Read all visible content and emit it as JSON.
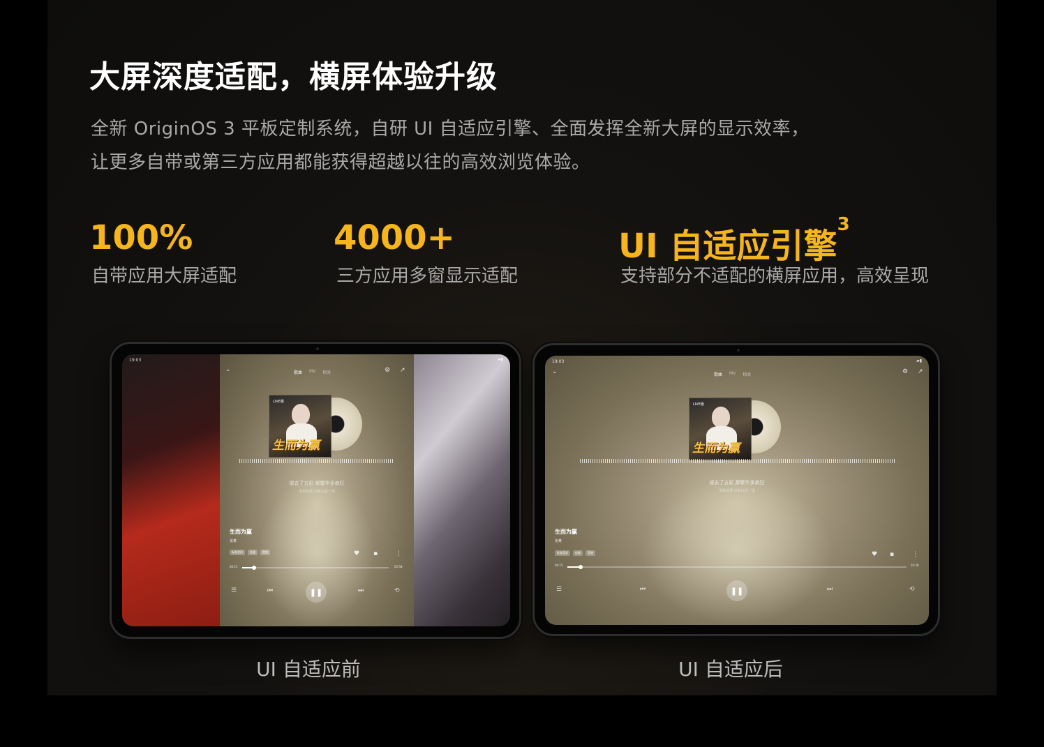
{
  "headline": "大屏深度适配，横屏体验升级",
  "description": {
    "line1": "全新 OriginOS 3 平板定制系统，自研 UI 自适应引擎、全面发挥全新大屏的显示效率，",
    "line2": "让更多自带或第三方应用都能获得超越以往的高效浏览体验。"
  },
  "stats": [
    {
      "value": "100%",
      "label": "自带应用大屏适配"
    },
    {
      "value": "4000+",
      "label": "三方应用多窗显示适配"
    },
    {
      "value": "UI 自适应引擎",
      "sup": "3",
      "label": "支持部分不适配的横屏应用，高效呈现"
    }
  ],
  "devices": {
    "before": {
      "caption": "UI 自适应前",
      "status_time": "19:03",
      "tabs": [
        "歌曲",
        "MV",
        "相关"
      ],
      "cover_text": "生而为赢",
      "cover_tag": "LIVE版",
      "lyric": "褪去了五彩 那繁华多疯狂",
      "lyric_sub": "没有如果 只有以后一场",
      "song_title": "生而为赢",
      "artist": "张某",
      "chips": [
        "标准音质",
        "倍速",
        "音效"
      ],
      "time_start": "00:15",
      "time_end": "03:58",
      "progress": 0.08
    },
    "after": {
      "caption": "UI 自适应后",
      "status_time": "19:03",
      "tabs": [
        "歌曲",
        "MV",
        "相关"
      ],
      "cover_text": "生而为赢",
      "cover_tag": "LIVE版",
      "lyric": "褪去了五彩 那繁华多疯狂",
      "lyric_sub": "没有如果 只有以后一场",
      "song_title": "生而为赢",
      "artist": "张某",
      "chips": [
        "标准音质",
        "倍速",
        "音效"
      ],
      "time_start": "00:15",
      "time_end": "03:58",
      "progress": 0.04
    }
  },
  "colors": {
    "accent": "#f6b41d",
    "background": "#000000",
    "panel": "#141210",
    "text_secondary": "#a9a9a9"
  }
}
